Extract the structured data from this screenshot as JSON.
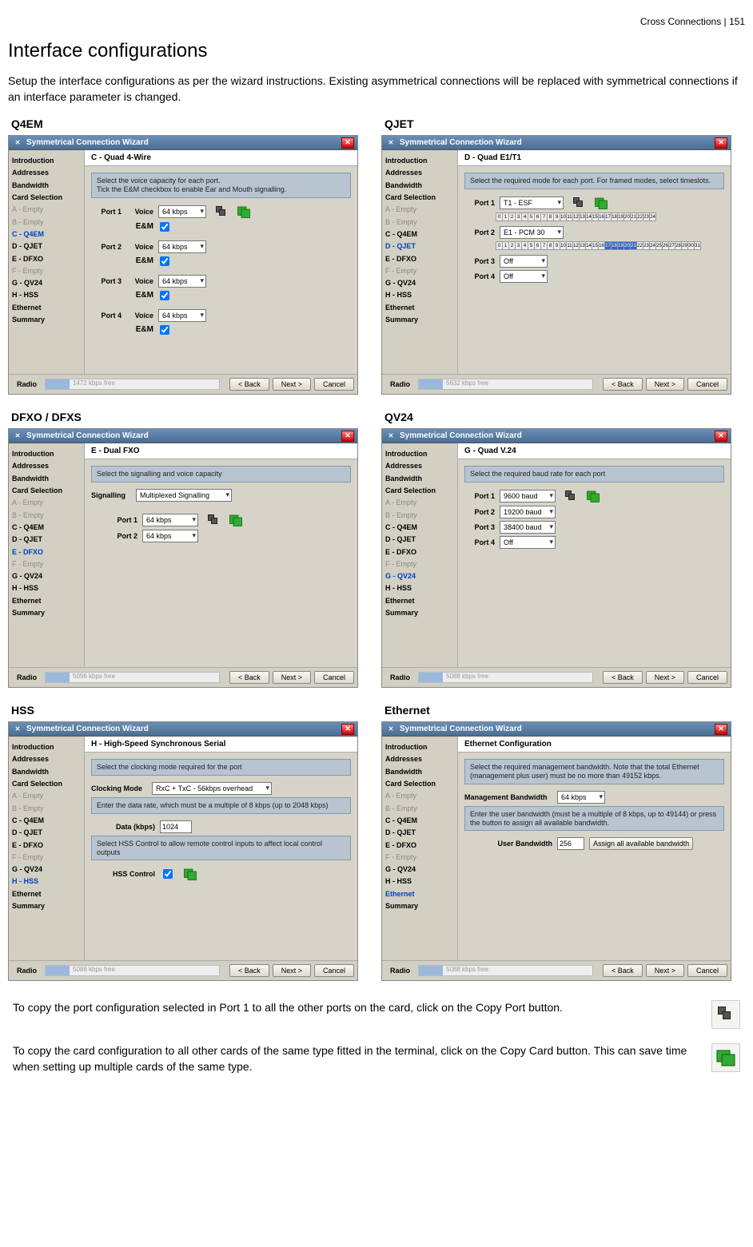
{
  "header": "Cross Connections  |  151",
  "title": "Interface configurations",
  "intro": "Setup the interface configurations as per the wizard instructions. Existing asymmetrical connections will be replaced with symmetrical connections if an interface parameter is changed.",
  "nav": {
    "items": [
      "Introduction",
      "Addresses",
      "Bandwidth",
      "Card Selection"
    ],
    "slots": [
      "A - Empty",
      "B - Empty",
      "C - Q4EM",
      "D - QJET",
      "E - DFXO",
      "F - Empty",
      "G - QV24",
      "H - HSS",
      "Ethernet",
      "Summary"
    ]
  },
  "common": {
    "wizard_title": "Symmetrical Connection Wizard",
    "radio_label": "Radio",
    "back_label": "< Back",
    "next_label": "Next >",
    "cancel_label": "Cancel"
  },
  "panels": {
    "q4em": {
      "name": "Q4EM",
      "content_title": "C - Quad 4-Wire",
      "instruction": "Select the voice capacity for each port.\nTick the E&M checkbox to enable Ear and Mouth signalling.",
      "voice_label": "Voice",
      "eam_label": "E&M",
      "port_labels": [
        "Port 1",
        "Port 2",
        "Port 3",
        "Port 4"
      ],
      "voice_value": "64 kbps",
      "free_text": "1472 kbps free"
    },
    "qjet": {
      "name": "QJET",
      "content_title": "D - Quad E1/T1",
      "instruction": "Select the required mode for each port. For framed modes, select timeslots.",
      "port_labels": [
        "Port 1",
        "Port 2",
        "Port 3",
        "Port 4"
      ],
      "port1_value": "T1 - ESF",
      "port2_value": "E1 - PCM 30",
      "off_value": "Off",
      "ts_label_p1": "0 1 2 3 4 5 6 7 8 9 10 11 12 13 14 15 16 17 18 19 20 21 22 23 24",
      "free_text": "5632 kbps free"
    },
    "dfxo": {
      "name": "DFXO / DFXS",
      "content_title": "E - Dual FXO",
      "instruction": "Select the signalling and voice capacity",
      "sig_label": "Signalling",
      "sig_value": "Multiplexed Signalling",
      "port_labels": [
        "Port 1",
        "Port 2"
      ],
      "voice_value": "64 kbps",
      "free_text": "5096 kbps free"
    },
    "qv24": {
      "name": "QV24",
      "content_title": "G - Quad V.24",
      "instruction": "Select the required baud rate for each port",
      "port_labels": [
        "Port 1",
        "Port 2",
        "Port 3",
        "Port 4"
      ],
      "values": [
        "9600 baud",
        "19200 baud",
        "38400 baud",
        "Off"
      ],
      "free_text": "5088 kbps free"
    },
    "hss": {
      "name": "HSS",
      "content_title": "H - High-Speed Synchronous Serial",
      "instruction1": "Select the clocking mode required for the port",
      "clock_label": "Clocking Mode",
      "clock_value": "RxC + TxC - 56kbps overhead",
      "instruction2": "Enter the data rate, which must be a multiple of 8 kbps (up to 2048 kbps)",
      "data_label": "Data (kbps)",
      "data_value": "1024",
      "instruction3": "Select HSS Control to allow remote control inputs to affect local control outputs",
      "hssctl_label": "HSS Control",
      "free_text": "5088 kbps free"
    },
    "ethernet": {
      "name": "Ethernet",
      "content_title": "Ethernet Configuration",
      "instruction1": "Select the required management bandwidth. Note that the total Ethernet (management plus user) must be no more than 49152 kbps.",
      "mgmt_label": "Management Bandwidth",
      "mgmt_value": "64 kbps",
      "instruction2": "Enter the user bandwidth (must be a multiple of 8 kbps, up to 49144) or press the button to assign all available bandwidth.",
      "user_label": "User Bandwidth",
      "user_value": "256",
      "assign_btn": "Assign all available bandwidth",
      "free_text": "5088 kbps free"
    }
  },
  "tips": {
    "copy_port": "To copy the port configuration selected in Port 1 to all the other ports on the card, click on the Copy Port button.",
    "copy_card": "To copy the card configuration to all other cards of the same type fitted in the terminal, click on the Copy Card button. This can save time when setting up multiple cards of the same type."
  }
}
